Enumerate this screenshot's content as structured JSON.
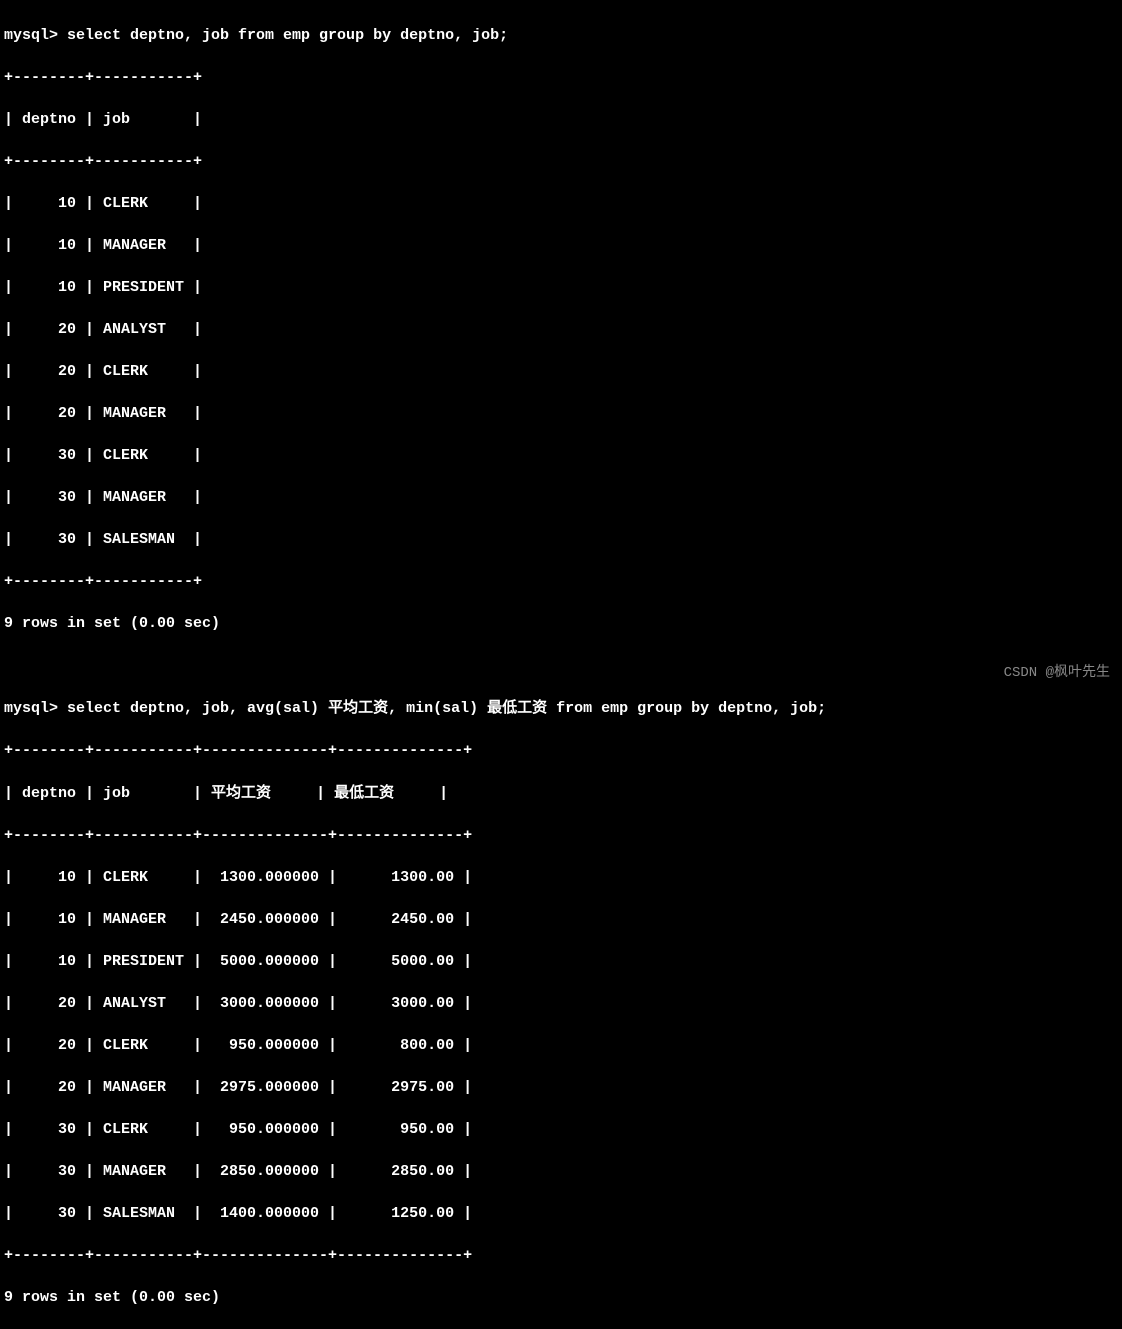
{
  "query1": {
    "prompt": "mysql> ",
    "sql": "select deptno, job from emp group by deptno, job;",
    "border_top": "+--------+-----------+",
    "header_line": "| deptno | job       |",
    "border_mid": "+--------+-----------+",
    "rows": [
      "|     10 | CLERK     |",
      "|     10 | MANAGER   |",
      "|     10 | PRESIDENT |",
      "|     20 | ANALYST   |",
      "|     20 | CLERK     |",
      "|     20 | MANAGER   |",
      "|     30 | CLERK     |",
      "|     30 | MANAGER   |",
      "|     30 | SALESMAN  |"
    ],
    "border_bot": "+--------+-----------+",
    "footer": "9 rows in set (0.00 sec)"
  },
  "query2": {
    "prompt": "mysql> ",
    "sql_pre": "select deptno, job, avg(sal) ",
    "sql_cjk1": "平均工资",
    "sql_mid": ", min(sal) ",
    "sql_cjk2": "最低工资",
    "sql_post": " from emp group by deptno, job;",
    "border_top": "+--------+-----------+--------------+--------------+",
    "header_pre": "| deptno | job       | ",
    "header_cjk1": "平均工资",
    "header_mid": "     | ",
    "header_cjk2": "最低工资",
    "header_post": "     |",
    "border_mid": "+--------+-----------+--------------+--------------+",
    "rows": [
      "|     10 | CLERK     |  1300.000000 |      1300.00 |",
      "|     10 | MANAGER   |  2450.000000 |      2450.00 |",
      "|     10 | PRESIDENT |  5000.000000 |      5000.00 |",
      "|     20 | ANALYST   |  3000.000000 |      3000.00 |",
      "|     20 | CLERK     |   950.000000 |       800.00 |",
      "|     20 | MANAGER   |  2975.000000 |      2975.00 |",
      "|     30 | CLERK     |   950.000000 |       950.00 |",
      "|     30 | MANAGER   |  2850.000000 |      2850.00 |",
      "|     30 | SALESMAN  |  1400.000000 |      1250.00 |"
    ],
    "border_bot": "+--------+-----------+--------------+--------------+",
    "footer": "9 rows in set (0.00 sec)"
  },
  "watermark": "CSDN @枫叶先生"
}
